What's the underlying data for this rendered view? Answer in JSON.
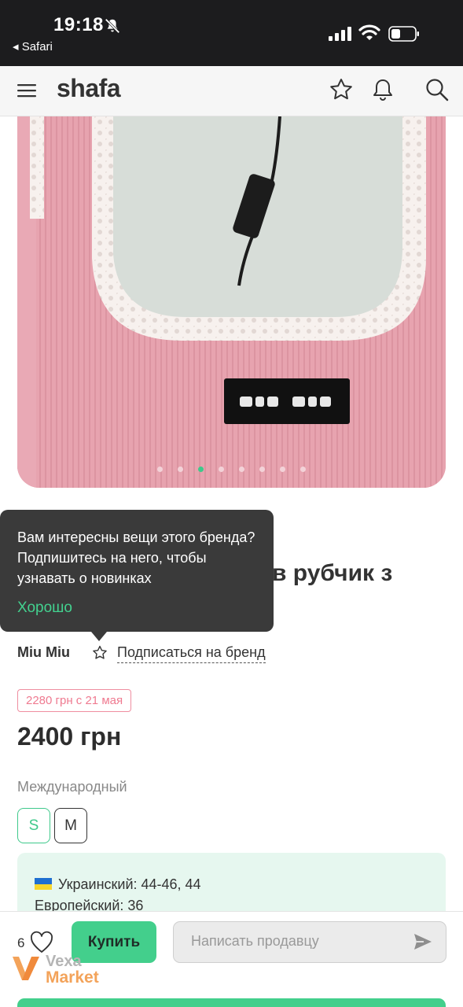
{
  "status_bar": {
    "time": "19:18",
    "back_app": "◂ Safari",
    "silent_mode": true,
    "battery_level": 0.35
  },
  "header": {
    "logo": "shafa",
    "icons": [
      "menu-icon",
      "star-icon",
      "bell-icon",
      "search-icon"
    ]
  },
  "gallery": {
    "image_count": 8,
    "active_index": 2,
    "image_description_icon": "product-photo"
  },
  "product": {
    "title_visible_part": "в рубчик з"
  },
  "tooltip": {
    "text": "Вам интересны вещи этого бренда? Подпишитесь на него, чтобы узнавать о новинках",
    "ok_label": "Хорошо"
  },
  "brand": {
    "name": "Miu Miu",
    "subscribe_label": "Подписаться на бренд"
  },
  "pricing": {
    "old_price_badge": "2280 грн с 21 мая",
    "price": "2400 грн"
  },
  "sizes": {
    "label": "Международный",
    "options": [
      "S",
      "M"
    ],
    "selected": "S"
  },
  "size_info": {
    "ukrainian": "Украинский: 44-46, 44",
    "european": "Европейский: 36"
  },
  "bottom_bar": {
    "likes": "6",
    "buy_label": "Купить",
    "message_placeholder": "Написать продавцу"
  },
  "watermark": {
    "line1": "Vexa",
    "line2": "Market"
  },
  "colors": {
    "accent_green": "#43cf8c",
    "old_price_pink": "#ef7a90",
    "tooltip_bg": "#3a3a3a"
  }
}
